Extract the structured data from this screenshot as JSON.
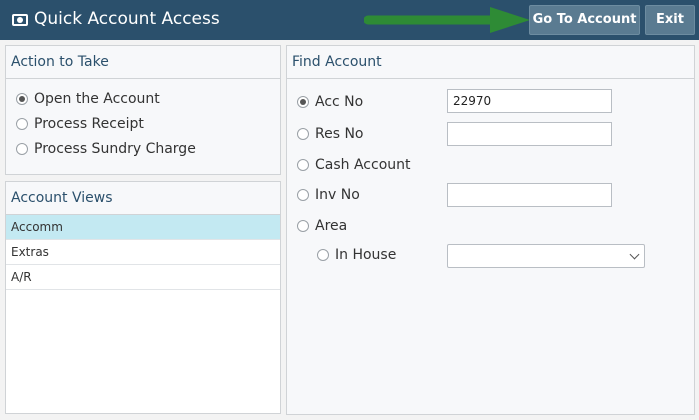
{
  "titlebar": {
    "title": "Quick Account Access",
    "icon": "money-icon",
    "go_to_account": "Go To Account",
    "exit": "Exit",
    "arrow_color": "#2e8b35"
  },
  "action_panel": {
    "title": "Action to Take",
    "options": [
      {
        "label": "Open the Account",
        "checked": true
      },
      {
        "label": "Process Receipt",
        "checked": false
      },
      {
        "label": "Process Sundry Charge",
        "checked": false
      }
    ]
  },
  "views_panel": {
    "title": "Account Views",
    "items": [
      {
        "label": "Accomm",
        "selected": true
      },
      {
        "label": "Extras",
        "selected": false
      },
      {
        "label": "A/R",
        "selected": false
      }
    ]
  },
  "find_panel": {
    "title": "Find Account",
    "acc_no": {
      "label": "Acc No",
      "value": "22970",
      "checked": true
    },
    "res_no": {
      "label": "Res No",
      "value": "",
      "checked": false
    },
    "cash_account": {
      "label": "Cash Account",
      "checked": false
    },
    "inv_no": {
      "label": "Inv No",
      "value": "",
      "checked": false
    },
    "area": {
      "label": "Area",
      "checked": false
    },
    "in_house": {
      "label": "In House",
      "checked": false,
      "selected": ""
    }
  },
  "colors": {
    "titlebar_bg": "#2b506c",
    "button_bg": "#5a7b91",
    "selected_row_bg": "#c3e9f2",
    "panel_heading": "#2b506c"
  }
}
